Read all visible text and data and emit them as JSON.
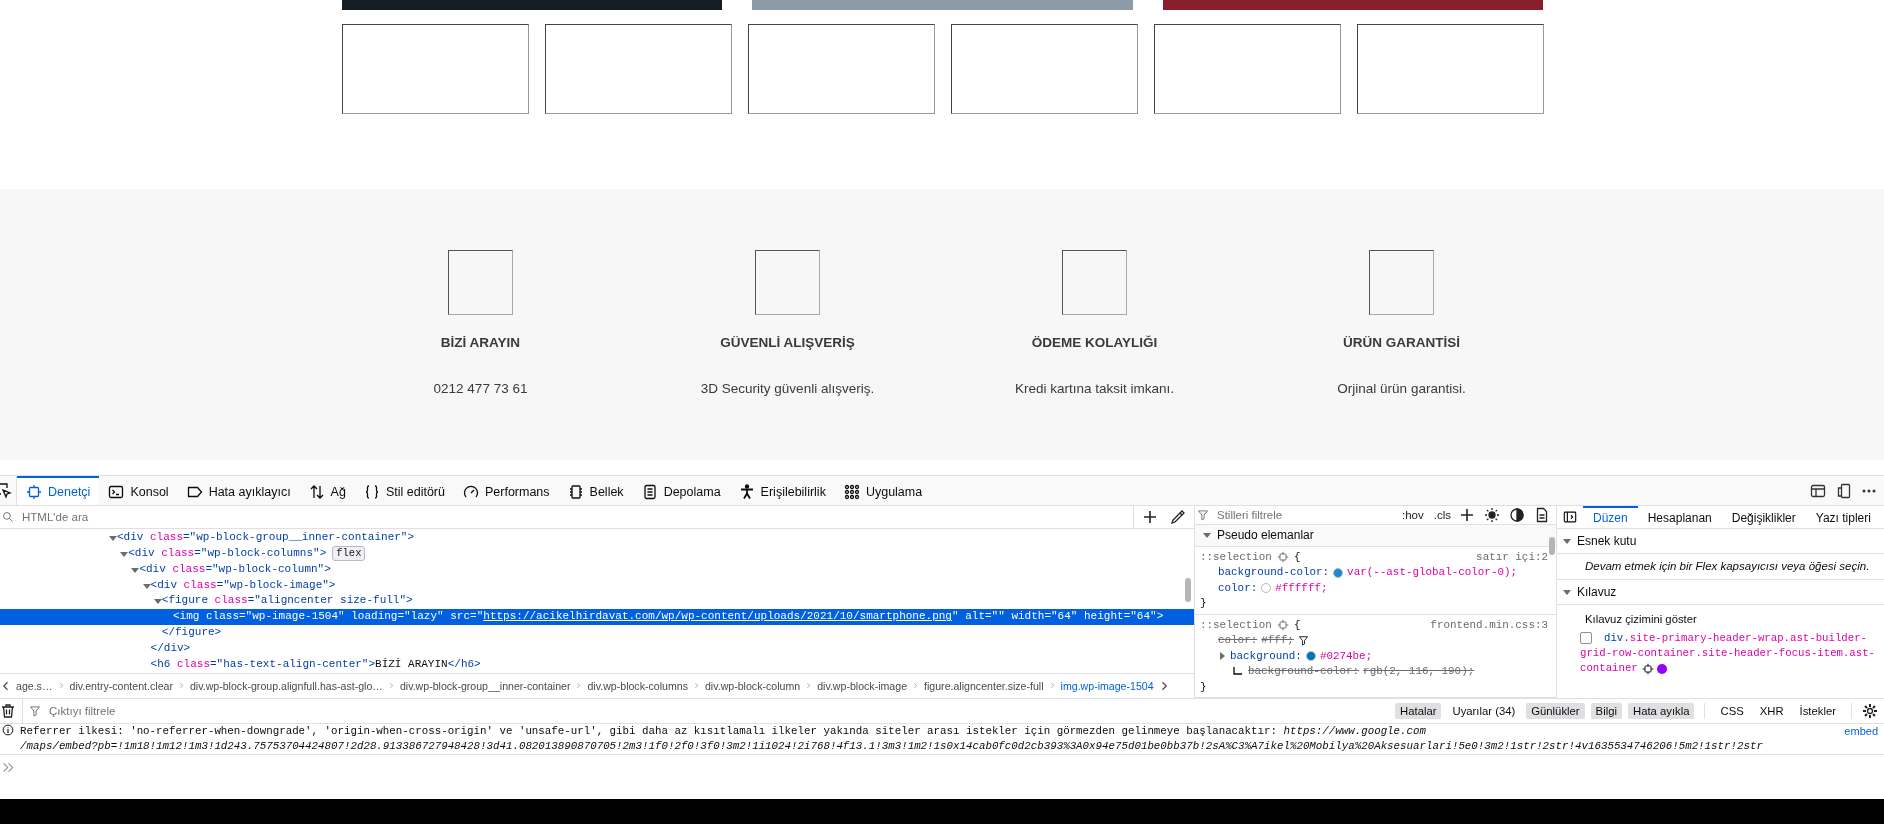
{
  "page": {
    "color_bars": [
      {
        "color": "#141c24"
      },
      {
        "color": "#8c9ba5"
      },
      {
        "color": "#87202c"
      }
    ],
    "image_boxes": [
      {
        "kind": "empty"
      },
      {
        "kind": "empty"
      },
      {
        "kind": "empty"
      },
      {
        "kind": "empty"
      },
      {
        "kind": "empty"
      },
      {
        "kind": "empty"
      }
    ],
    "features": [
      {
        "title": "BİZİ ARAYIN",
        "text": "0212 477 73 61"
      },
      {
        "title": "GÜVENLİ ALIŞVERİŞ",
        "text": "3D Security güvenli alışveriş."
      },
      {
        "title": "ÖDEME KOLAYLIĞI",
        "text": "Kredi kartına taksit imkanı."
      },
      {
        "title": "ÜRÜN GARANTİSİ",
        "text": "Orjinal ürün garantisi."
      }
    ]
  },
  "devtools": {
    "tabs": [
      {
        "label": "Denetçi",
        "kind": "inspector",
        "selected": true
      },
      {
        "label": "Konsol",
        "kind": "console",
        "selected": false
      },
      {
        "label": "Hata ayıklayıcı",
        "kind": "debugger",
        "selected": false
      },
      {
        "label": "Ağ",
        "kind": "network",
        "selected": false
      },
      {
        "label": "Stil editörü",
        "kind": "style-editor",
        "selected": false
      },
      {
        "label": "Performans",
        "kind": "performance",
        "selected": false
      },
      {
        "label": "Bellek",
        "kind": "memory",
        "selected": false
      },
      {
        "label": "Depolama",
        "kind": "storage",
        "selected": false
      },
      {
        "label": "Erişilebilirlik",
        "kind": "accessibility",
        "selected": false
      },
      {
        "label": "Uygulama",
        "kind": "application",
        "selected": false
      }
    ],
    "inspector": {
      "search_placeholder": "HTML'de ara",
      "tree": [
        {
          "expanded": true,
          "selected": false,
          "tokens": [
            {
              "t": "<div",
              "kind": "tag"
            },
            {
              "t": " class",
              "kind": "attr"
            },
            {
              "t": "=\"wp-block-group__inner-container\"",
              "kind": "value"
            },
            {
              "t": ">",
              "kind": "tag"
            }
          ],
          "children": [
            {
              "expanded": true,
              "selected": false,
              "badge": "flex",
              "tokens": [
                {
                  "t": "<div",
                  "kind": "tag"
                },
                {
                  "t": " class",
                  "kind": "attr"
                },
                {
                  "t": "=\"wp-block-columns\"",
                  "kind": "value"
                },
                {
                  "t": ">",
                  "kind": "tag"
                }
              ],
              "children": [
                {
                  "expanded": true,
                  "selected": false,
                  "tokens": [
                    {
                      "t": "<div",
                      "kind": "tag"
                    },
                    {
                      "t": " class",
                      "kind": "attr"
                    },
                    {
                      "t": "=\"wp-block-column\"",
                      "kind": "value"
                    },
                    {
                      "t": ">",
                      "kind": "tag"
                    }
                  ],
                  "children": [
                    {
                      "expanded": true,
                      "selected": false,
                      "tokens": [
                        {
                          "t": "<div",
                          "kind": "tag"
                        },
                        {
                          "t": " class",
                          "kind": "attr"
                        },
                        {
                          "t": "=\"wp-block-image\"",
                          "kind": "value"
                        },
                        {
                          "t": ">",
                          "kind": "tag"
                        }
                      ],
                      "closing": [
                        {
                          "t": "</div>",
                          "kind": "tag"
                        }
                      ],
                      "children": [
                        {
                          "expanded": true,
                          "selected": false,
                          "tokens": [
                            {
                              "t": "<figure",
                              "kind": "tag"
                            },
                            {
                              "t": " class",
                              "kind": "attr"
                            },
                            {
                              "t": "=\"aligncenter size-full\"",
                              "kind": "value"
                            },
                            {
                              "t": ">",
                              "kind": "tag"
                            }
                          ],
                          "closing": [
                            {
                              "t": "</figure>",
                              "kind": "tag"
                            }
                          ],
                          "children": [
                            {
                              "selected": true,
                              "tokens": [
                                {
                                  "t": "<img",
                                  "kind": "tag"
                                },
                                {
                                  "t": " class",
                                  "kind": "attr"
                                },
                                {
                                  "t": "=\"wp-image-1504\"",
                                  "kind": "value"
                                },
                                {
                                  "t": " loading",
                                  "kind": "attr"
                                },
                                {
                                  "t": "=\"lazy\"",
                                  "kind": "value"
                                },
                                {
                                  "t": " src",
                                  "kind": "attr"
                                },
                                {
                                  "t": "=\"",
                                  "kind": "value"
                                },
                                {
                                  "t": "https://acikelhirdavat.com/wp/wp-content/uploads/2021/10/smartphone.png",
                                  "kind": "link"
                                },
                                {
                                  "t": "\"",
                                  "kind": "value"
                                },
                                {
                                  "t": " alt",
                                  "kind": "attr"
                                },
                                {
                                  "t": "=\"\"",
                                  "kind": "value"
                                },
                                {
                                  "t": " width",
                                  "kind": "attr"
                                },
                                {
                                  "t": "=\"64\"",
                                  "kind": "value"
                                },
                                {
                                  "t": " height",
                                  "kind": "attr"
                                },
                                {
                                  "t": "=\"64\"",
                                  "kind": "value"
                                },
                                {
                                  "t": ">",
                                  "kind": "tag"
                                }
                              ]
                            }
                          ]
                        }
                      ]
                    },
                    {
                      "selected": false,
                      "tokens": [
                        {
                          "t": "<h6",
                          "kind": "tag"
                        },
                        {
                          "t": " class",
                          "kind": "attr"
                        },
                        {
                          "t": "=\"has-text-align-center\"",
                          "kind": "value"
                        },
                        {
                          "t": ">",
                          "kind": "tag"
                        },
                        {
                          "t": "BİZİ ARAYIN",
                          "kind": "text"
                        },
                        {
                          "t": "</h6>",
                          "kind": "tag"
                        }
                      ]
                    }
                  ]
                }
              ]
            }
          ]
        }
      ],
      "breadcrumbs": [
        {
          "label": "age.s…",
          "selected": false
        },
        {
          "label": "div.entry-content.clear",
          "selected": false
        },
        {
          "label": "div.wp-block-group.alignfull.has-ast-glo…",
          "selected": false
        },
        {
          "label": "div.wp-block-group__inner-container",
          "selected": false
        },
        {
          "label": "div.wp-block-columns",
          "selected": false
        },
        {
          "label": "div.wp-block-column",
          "selected": false
        },
        {
          "label": "div.wp-block-image",
          "selected": false
        },
        {
          "label": "figure.aligncenter.size-full",
          "selected": false
        },
        {
          "label": "img.wp-image-1504",
          "selected": true
        }
      ]
    },
    "styles": {
      "filter_placeholder": "Stilleri filtrele",
      "hov": ":hov",
      "cls": ".cls",
      "section": {
        "label": "Pseudo elemanlar",
        "expanded": true
      },
      "rules": [
        {
          "selector": "::selection",
          "open": "{",
          "close": "}",
          "source": "satır içi:2",
          "declarations": [
            {
              "prop": "background-color:",
              "value": "var(--ast-global-color-0);",
              "color": "#1e88d2",
              "overridden": false
            },
            {
              "prop": "color:",
              "value": "#ffffff;",
              "color": "#ffffff",
              "overridden": false
            }
          ]
        },
        {
          "selector": "::selection",
          "open": "{",
          "close": "}",
          "source": "frontend.min.css:3",
          "declarations": [
            {
              "prop": "color:",
              "value": "#fff;",
              "overridden": true,
              "filter_button": true
            },
            {
              "prop": "background:",
              "value": "#0274be;",
              "color": "#0274be",
              "overridden": false,
              "expandable": true,
              "sub": [
                {
                  "prop": "background-color:",
                  "value": "rgb(2, 116, 190);",
                  "overridden": true
                }
              ]
            }
          ]
        }
      ]
    },
    "layout": {
      "tabs": [
        {
          "label": "Düzen",
          "selected": true
        },
        {
          "label": "Hesaplanan",
          "selected": false
        },
        {
          "label": "Değişiklikler",
          "selected": false
        },
        {
          "label": "Yazı tipleri",
          "selected": false
        }
      ],
      "flex_section": {
        "label": "Esnek kutu",
        "expanded": true,
        "message": "Devam etmek için bir Flex kapsayıcısı veya öğesi seçin."
      },
      "grid_section": {
        "label": "Kılavuz",
        "expanded": true,
        "heading": "Kılavuz çizimini göster",
        "containers": [
          {
            "tag": "div",
            "classes": ".site-primary-header-wrap.ast-builder-grid-row-container.site-header-focus-item.ast-container",
            "checked": false,
            "color": "#9400ff"
          }
        ]
      }
    },
    "console": {
      "filter_placeholder": "Çıktıyı filtrele",
      "level_filters": [
        {
          "label": "Hatalar",
          "selected": true
        },
        {
          "label": "Uyarılar (34)",
          "selected": false
        },
        {
          "label": "Günlükler",
          "selected": true
        },
        {
          "label": "Bilgi",
          "selected": true
        },
        {
          "label": "Hata ayıkla",
          "selected": true
        }
      ],
      "request_filters": [
        {
          "label": "CSS",
          "selected": false
        },
        {
          "label": "XHR",
          "selected": false
        },
        {
          "label": "İstekler",
          "selected": false
        }
      ],
      "messages": [
        {
          "kind": "info",
          "lines": [
            "Referrer ilkesi: 'no-referrer-when-downgrade', 'origin-when-cross-origin' ve 'unsafe-url', gibi daha az kısıtlamalı ilkeler yakında siteler arası istekler için görmezden gelinmeye başlanacaktır: *https://www.google.com*",
            "*/maps/embed?pb=!1m18!1m12!1m3!1d243.75753704424807!2d28.913386727948428!3d41.082013890870705!2m3!1f0!2f0!3f0!3m2!1i1024!2i768!4f13.1!3m3!1m2!1s0x14cab0fc0d2cb393%3A0x94e75d01be0bb37b!2sA%C3%A7ikel%20Mobilya%20Aksesuarlari!5e0!3m2!1str!2str!4v1635534746206!5m2!1str!2str*"
          ],
          "source": "embed"
        }
      ]
    }
  }
}
